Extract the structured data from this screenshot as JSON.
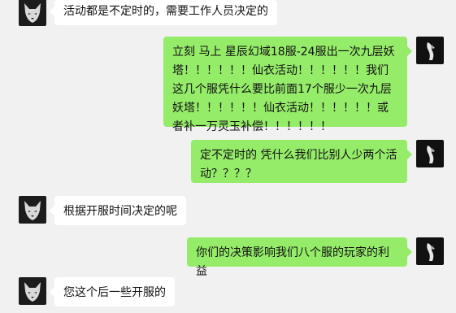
{
  "chat": {
    "messages": [
      {
        "side": "in",
        "avatar": "peer-avatar",
        "text": "活动都是不定时的，需要工作人员决定的"
      },
      {
        "side": "out",
        "avatar": "self-avatar",
        "text": "立刻 马上 星辰幻域18服-24服出一次九层妖塔！！！！！！仙衣活动！！！！！！我们这几个服凭什么要比前面17个服少一次九层妖塔！！！！！！仙衣活动！！！！！！或者补一万灵玉补偿！！！！！！"
      },
      {
        "side": "out",
        "avatar": "self-avatar",
        "text": "定不定时的  凭什么我们比别人少两个活动？？？？"
      },
      {
        "side": "in",
        "avatar": "peer-avatar",
        "text": "根据开服时间决定的呢"
      },
      {
        "side": "out",
        "avatar": "self-avatar",
        "text": "你们的决策影响我们八个服的玩家的利益"
      },
      {
        "side": "in",
        "avatar": "peer-avatar",
        "text": "您这个后一些开服的"
      }
    ]
  },
  "colors": {
    "background": "#f1f1f1",
    "incoming_bubble": "#ffffff",
    "outgoing_bubble": "#95ec69"
  }
}
